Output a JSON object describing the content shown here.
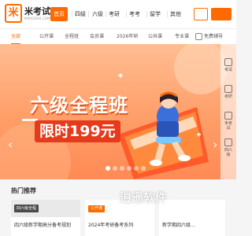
{
  "logo": {
    "mark": "米",
    "name": "米考试",
    "sub": "MIKAOSHI.COM"
  },
  "nav": {
    "items": [
      "首页",
      "四级",
      "六级",
      "考研",
      "考考",
      "留学",
      "其他"
    ],
    "active_index": 0
  },
  "header_buttons": [
    "login",
    "register"
  ],
  "categories": [
    "全部",
    "公开课",
    "全程班",
    "会员课",
    "2026年研",
    "公共课",
    "专业课",
    "免费辅导"
  ],
  "banner": {
    "title": "六级全程班",
    "price": "限时199元",
    "slide_count": 6,
    "active_slide": 1,
    "prev": "‹",
    "next": "›"
  },
  "floating": [
    {
      "label": "考试"
    },
    {
      "label": "考研"
    },
    {
      "label": "米考试"
    },
    {
      "label": "四六级"
    }
  ],
  "hot": {
    "title": "热门推荐",
    "cards": [
      {
        "tag": "四六级全程",
        "text": "四六级新学期高分备考规划"
      },
      {
        "tag": "公开课",
        "text": "2024年考研备考系列"
      },
      {
        "tag": "",
        "text": "新学期四六级…"
      }
    ]
  },
  "watermark": "逍遥软件",
  "colors": {
    "accent": "#ff6a00",
    "banner": "#ff9e68",
    "price": "#e53a1b"
  }
}
